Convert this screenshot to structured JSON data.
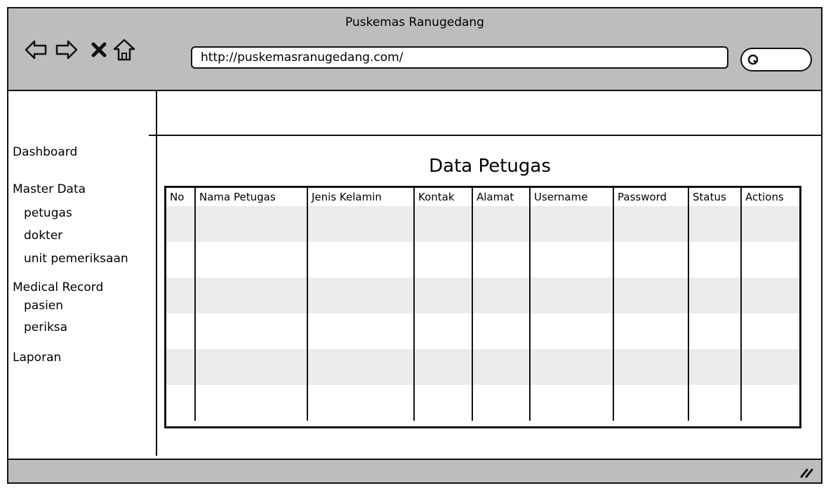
{
  "window": {
    "title": "Puskemas Ranugedang"
  },
  "browser": {
    "url": "http://puskemasranugedang.com/"
  },
  "icons": {
    "back": "back-arrow-icon",
    "forward": "forward-arrow-icon",
    "stop": "close-icon",
    "home": "home-icon",
    "search": "search-icon",
    "resize": "resize-grip-icon"
  },
  "sidebar": {
    "items": [
      {
        "label": "Dashboard"
      },
      {
        "label": "Master Data"
      },
      {
        "label": "petugas"
      },
      {
        "label": "dokter"
      },
      {
        "label": "unit pemeriksaan"
      },
      {
        "label": "Medical Record"
      },
      {
        "label": "pasien"
      },
      {
        "label": "periksa"
      },
      {
        "label": "Laporan"
      }
    ]
  },
  "main": {
    "title": "Data Petugas",
    "table": {
      "columns": [
        "No",
        "Nama Petugas",
        "Jenis Kelamin",
        "Kontak",
        "Alamat",
        "Username",
        "Password",
        "Status",
        "Actions"
      ]
    }
  },
  "colors": {
    "chrome": "#bdbdbd",
    "stripe": "#ebebeb",
    "ink": "#111111"
  }
}
